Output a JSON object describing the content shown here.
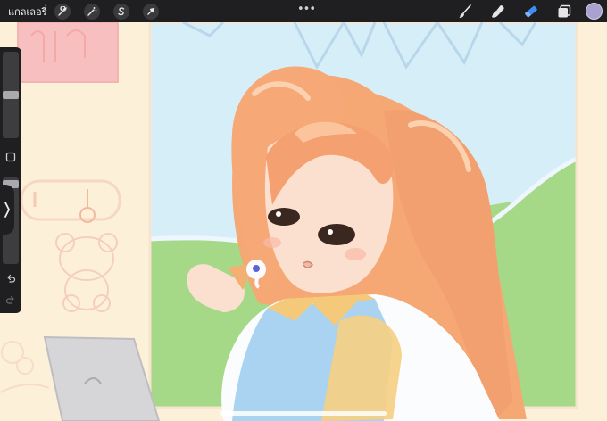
{
  "topbar": {
    "gallery_label": "แกลเลอรี่",
    "left_tools": [
      "wrench-icon",
      "magic-wand-icon",
      "selection-s-icon",
      "transform-arrow-icon"
    ],
    "more_label": "•••",
    "right_tools": [
      "brush-icon",
      "smudge-icon",
      "eraser-icon",
      "layers-icon"
    ],
    "active_tool": "eraser-icon",
    "current_color": "#a9a1cf"
  },
  "sidebar": {
    "brush_size_level": 0.5,
    "opacity_level": 0.97,
    "icons": [
      "modify-square-icon",
      "undo-icon",
      "redo-icon"
    ]
  },
  "colors": {
    "accent_blue": "#3d8df5",
    "toolbar_bg": "#1f1f21",
    "icon_light": "#e6e6e6"
  }
}
